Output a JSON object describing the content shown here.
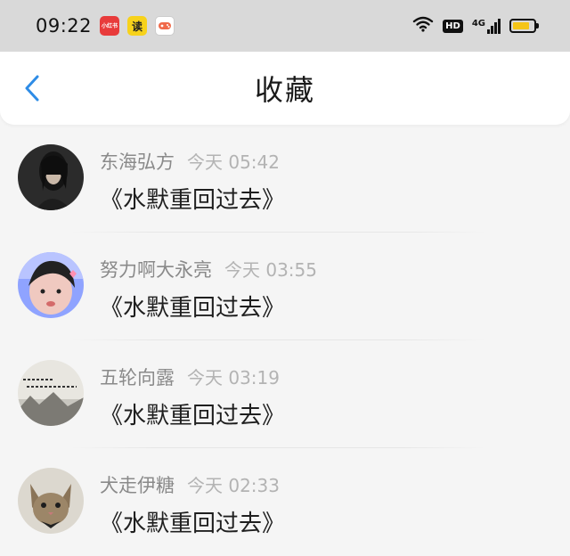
{
  "status_bar": {
    "time": "09:22",
    "network": "4G",
    "hd": "HD",
    "app_icons": [
      {
        "name": "xiaohongshu-icon",
        "label": "小红书"
      },
      {
        "name": "reader-icon",
        "label": "读"
      },
      {
        "name": "game-center-icon",
        "label": ""
      }
    ]
  },
  "header": {
    "title": "收藏",
    "back_icon": "chevron-left-icon"
  },
  "items": [
    {
      "name": "东海弘方",
      "time": "今天 05:42",
      "title": "《水默重回过去》"
    },
    {
      "name": "努力啊大永亮",
      "time": "今天 03:55",
      "title": "《水默重回过去》"
    },
    {
      "name": "五轮向露",
      "time": "今天 03:19",
      "title": "《水默重回过去》"
    },
    {
      "name": "犬走伊糖",
      "time": "今天 02:33",
      "title": "《水默重回过去》"
    }
  ],
  "colors": {
    "accent": "#2e8ce6",
    "status_bar_bg": "#d9d9d9",
    "page_bg": "#f5f5f5"
  }
}
